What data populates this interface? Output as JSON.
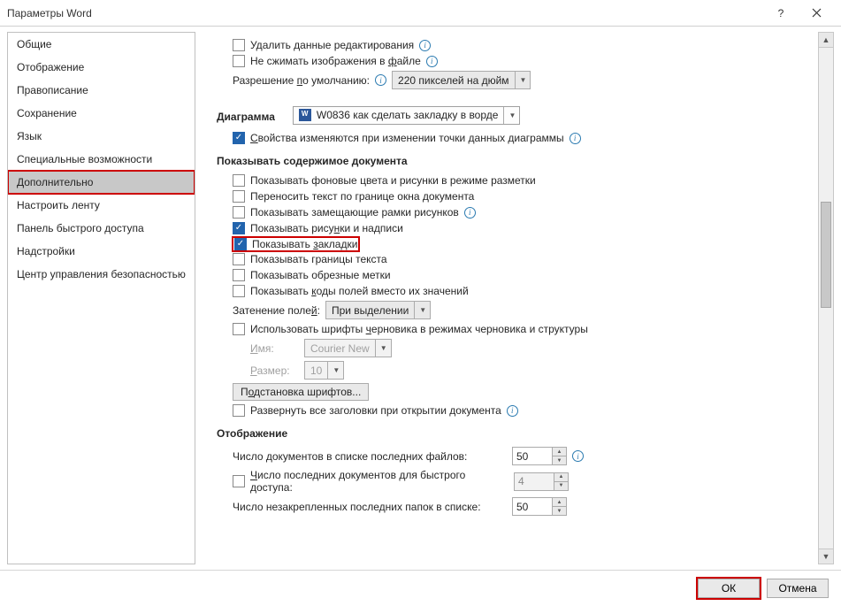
{
  "title": "Параметры Word",
  "sidebar": {
    "items": [
      {
        "label": "Общие"
      },
      {
        "label": "Отображение"
      },
      {
        "label": "Правописание"
      },
      {
        "label": "Сохранение"
      },
      {
        "label": "Язык"
      },
      {
        "label": "Специальные возможности"
      },
      {
        "label": "Дополнительно"
      },
      {
        "label": "Настроить ленту"
      },
      {
        "label": "Панель быстрого доступа"
      },
      {
        "label": "Надстройки"
      },
      {
        "label": "Центр управления безопасностью"
      }
    ]
  },
  "c": {
    "del_edit": "Удалить данные редактирования",
    "no_compress": "Не сжимать изображения в файле",
    "res_lbl": "Разрешение по умолчанию:",
    "res_val": "220 пикселей на дюйм",
    "diagram_lbl": "Диаграмма",
    "diagram_doc": "W0836 как сделать закладку в ворде",
    "diag_chk": "Свойства изменяются при изменении точки данных диаграммы",
    "sec_doc": "Показывать содержимое документа",
    "bg": "Показывать фоновые цвета и рисунки в режиме разметки",
    "wrap": "Переносить текст по границе окна документа",
    "placeh": "Показывать замещающие рамки рисунков",
    "draw": "Показывать рисунки и надписи",
    "bookmarks": "Показывать закладки",
    "txtbounds": "Показывать границы текста",
    "crop": "Показывать обрезные метки",
    "codes": "Показывать коды полей вместо их значений",
    "shade_lbl": "Затенение полей:",
    "shade_val": "При выделении",
    "draft_font": "Использовать шрифты черновика в режимах черновика и структуры",
    "name_lbl": "Имя:",
    "name_val": "Courier New",
    "size_lbl": "Размер:",
    "size_val": "10",
    "subst": "Подстановка шрифтов...",
    "expand": "Развернуть все заголовки при открытии документа",
    "sec_disp": "Отображение",
    "recent_docs": "Число документов в списке последних файлов:",
    "recent_val": "50",
    "quick_docs": "Число последних документов для быстрого доступа:",
    "quick_val": "4",
    "pinned": "Число незакрепленных последних папок в списке:",
    "pinned_val": "50"
  },
  "footer": {
    "ok": "ОК",
    "cancel": "Отмена"
  }
}
